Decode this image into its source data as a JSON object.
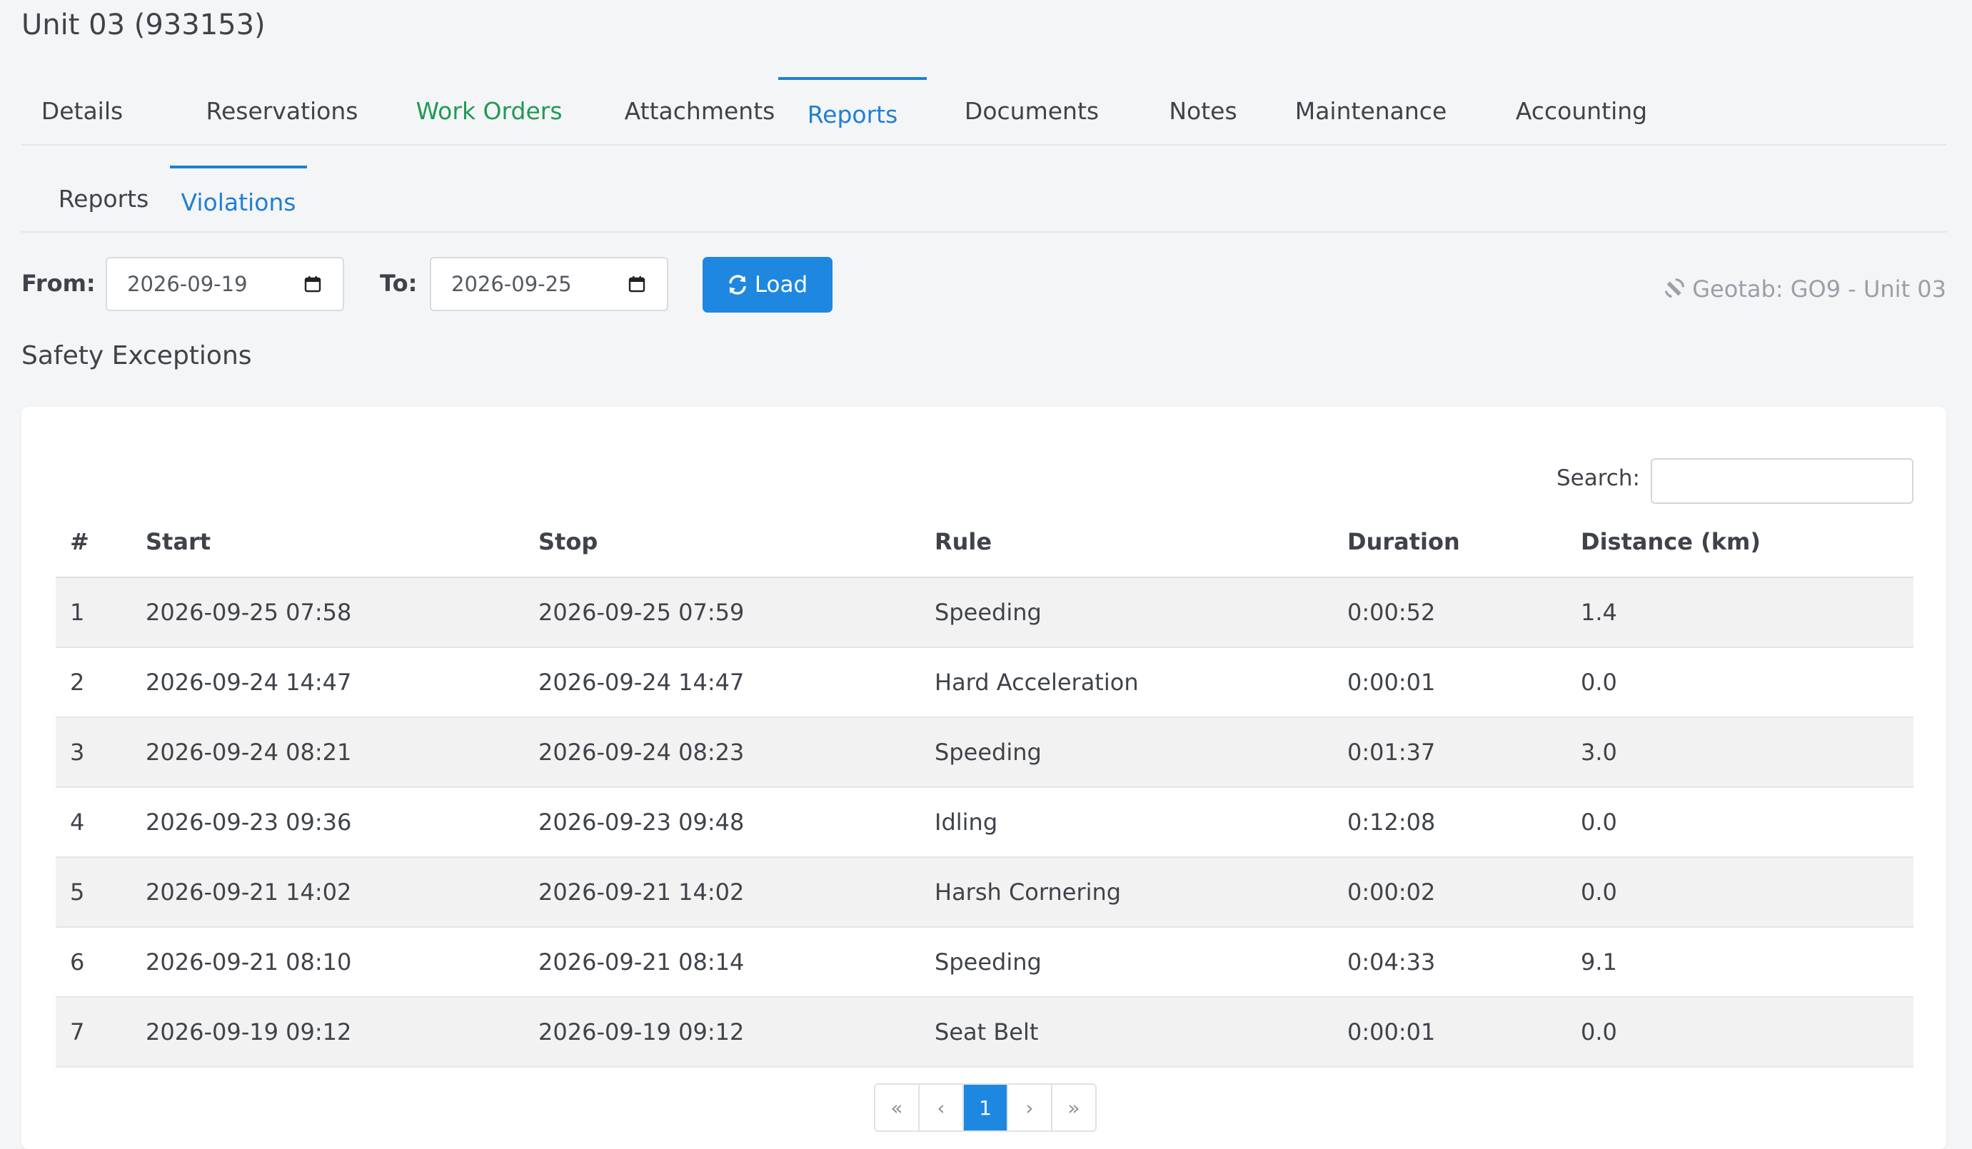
{
  "page_title": "Unit 03 (933153)",
  "main_tabs": [
    {
      "label": "Details"
    },
    {
      "label": "Reservations"
    },
    {
      "label": "Work Orders"
    },
    {
      "label": "Attachments"
    },
    {
      "label": "Reports"
    },
    {
      "label": "Documents"
    },
    {
      "label": "Notes"
    },
    {
      "label": "Maintenance"
    },
    {
      "label": "Accounting"
    }
  ],
  "active_main_tab": "Reports",
  "sub_tabs": [
    {
      "label": "Reports"
    },
    {
      "label": "Violations"
    }
  ],
  "active_sub_tab": "Violations",
  "filter": {
    "from_label": "From:",
    "from_value": "2026-09-19",
    "to_label": "To:",
    "to_value": "2026-09-25",
    "load_label": "Load"
  },
  "device_label": "Geotab: GO9 - Unit 03",
  "section_title": "Safety Exceptions",
  "search": {
    "label": "Search:",
    "value": ""
  },
  "table": {
    "columns": [
      "#",
      "Start",
      "Stop",
      "Rule",
      "Duration",
      "Distance (km)"
    ],
    "rows": [
      [
        "1",
        "2026-09-25 07:58",
        "2026-09-25 07:59",
        "Speeding",
        "0:00:52",
        "1.4"
      ],
      [
        "2",
        "2026-09-24 14:47",
        "2026-09-24 14:47",
        "Hard Acceleration",
        "0:00:01",
        "0.0"
      ],
      [
        "3",
        "2026-09-24 08:21",
        "2026-09-24 08:23",
        "Speeding",
        "0:01:37",
        "3.0"
      ],
      [
        "4",
        "2026-09-23 09:36",
        "2026-09-23 09:48",
        "Idling",
        "0:12:08",
        "0.0"
      ],
      [
        "5",
        "2026-09-21 14:02",
        "2026-09-21 14:02",
        "Harsh Cornering",
        "0:00:02",
        "0.0"
      ],
      [
        "6",
        "2026-09-21 08:10",
        "2026-09-21 08:14",
        "Speeding",
        "0:04:33",
        "9.1"
      ],
      [
        "7",
        "2026-09-19 09:12",
        "2026-09-19 09:12",
        "Seat Belt",
        "0:00:01",
        "0.0"
      ]
    ]
  },
  "pagination": {
    "first": "«",
    "prev": "‹",
    "current": "1",
    "next": "›",
    "last": "»"
  },
  "colors": {
    "accent": "#1e87e0",
    "green_tab": "#1f9a54"
  },
  "icons": {
    "load": "refresh-icon",
    "device": "satellite-icon",
    "date": "calendar-icon"
  }
}
